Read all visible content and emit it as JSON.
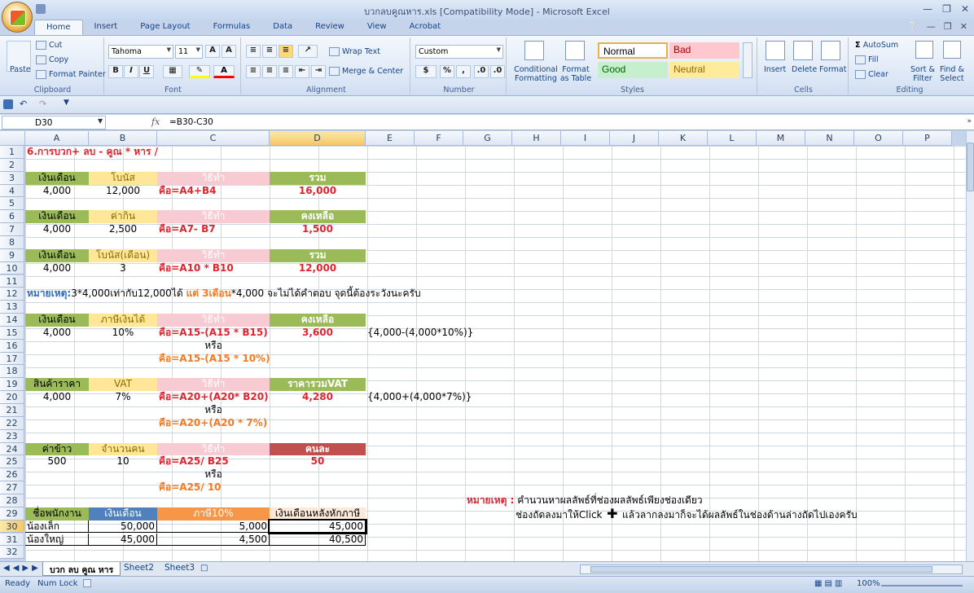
{
  "window": {
    "title": "บวกลบคูณหาร.xls  [Compatibility Mode] - Microsoft Excel"
  },
  "ribbon": {
    "tabs": [
      "Home",
      "Insert",
      "Page Layout",
      "Formulas",
      "Data",
      "Review",
      "View",
      "Acrobat"
    ],
    "clipboard": {
      "label": "Clipboard",
      "paste": "Paste",
      "cut": "Cut",
      "copy": "Copy",
      "format_painter": "Format Painter"
    },
    "font": {
      "label": "Font",
      "name": "Tahoma",
      "size": "11"
    },
    "alignment": {
      "label": "Alignment",
      "wrap": "Wrap Text",
      "merge": "Merge & Center"
    },
    "number": {
      "label": "Number",
      "format": "Custom"
    },
    "styles": {
      "label": "Styles",
      "conditional": "Conditional",
      "formatting": "Formatting",
      "format_as": "Format",
      "as_table": "as Table",
      "normal": "Normal",
      "bad": "Bad",
      "good": "Good",
      "neutral": "Neutral"
    },
    "cells": {
      "label": "Cells",
      "insert": "Insert",
      "delete": "Delete",
      "format": "Format"
    },
    "editing": {
      "label": "Editing",
      "autosum": "AutoSum",
      "fill": "Fill",
      "clear": "Clear",
      "sort": "Sort &",
      "filter": "Filter",
      "find": "Find &",
      "select": "Select"
    }
  },
  "formula_bar": {
    "name_box": "D30",
    "formula": "=B30-C30"
  },
  "columns": [
    "A",
    "B",
    "C",
    "D",
    "E",
    "F",
    "G",
    "H",
    "I",
    "J",
    "K",
    "L",
    "M",
    "N",
    "O",
    "P"
  ],
  "rows": [
    "1",
    "2",
    "3",
    "4",
    "5",
    "6",
    "7",
    "8",
    "9",
    "10",
    "11",
    "12",
    "13",
    "14",
    "15",
    "16",
    "17",
    "18",
    "19",
    "20",
    "21",
    "22",
    "23",
    "24",
    "25",
    "26",
    "27",
    "28",
    "29",
    "30",
    "31",
    "32"
  ],
  "cells": {
    "r1": "6.การบวก+ ลบ - คูณ * หาร /",
    "h_salary": "เงินเดือน",
    "h_bonus": "โบนัส",
    "h_method": "วิธีทำ",
    "h_total": "รวม",
    "r4a": "4,000",
    "r4b": "12,000",
    "r4c": "คือ=A4+B4",
    "r4d": "16,000",
    "h_food": "ค่ากิน",
    "h_remain": "คงเหลือ",
    "r7a": "4,000",
    "r7b": "2,500",
    "r7c": "คือ=A7- B7",
    "r7d": "1,500",
    "h_bonus_m": "โบนัส(เดือน)",
    "r10a": "4,000",
    "r10b": "3",
    "r10c": "คือ=A10 * B10",
    "r10d": "12,000",
    "r12_label": "หมายเหตุ:",
    "r12_text1": "3*4,000เท่ากับ12,000ได้ ",
    "r12_text2": "แต่ 3เดือน",
    "r12_text3": "*4,000 จะไม่ได้คำตอบ จุดนี้ต้องระวังนะครับ",
    "h_tax": "ภาษีเงินได้",
    "r15a": "4,000",
    "r15b": "10%",
    "r15c": "คือ=A15-(A15 * B15)",
    "r15d": "3,600",
    "r15e": "{4,000-(4,000*10%)}",
    "or": "หรือ",
    "r17c": "คือ=A15-(A15 * 10%)",
    "h_product": "สินค้าราคา",
    "h_vat": "VAT",
    "h_totalvat": "ราคารวมVAT",
    "r20a": "4,000",
    "r20b": "7%",
    "r20c": "คือ=A20+(A20* B20)",
    "r20d": "4,280",
    "r20e": "{4,000+(4,000*7%)}",
    "r22c": "คือ=A20+(A20 * 7%)",
    "h_rice": "ค่าข้าว",
    "h_people": "จำนวนคน",
    "h_per": "คนละ",
    "r25a": "500",
    "r25b": "10",
    "r25c": "คือ=A25/ B25",
    "r25d": "50",
    "r27c": "คือ=A25/ 10",
    "r28_label": "หมายเหตุ :",
    "r28_text": "คำนวนหาผลลัพธ์ที่ช่องผลลัพธ์เพียงช่องเดียว",
    "r29_text1": "ช่องถัดลงมาให้Click",
    "r29_text2": "แล้วลากลงมาก็จะได้ผลลัพธ์ในช่องด้านล่างถัดไปเองครับ",
    "h_emp": "ชื่อพนักงาน",
    "h_sal2": "เงินเดือน",
    "h_tax10": "ภาษี10%",
    "h_net": "เงินเดือนหลังหักภาษี",
    "r30a": "น้องเล็ก",
    "r30b": "50,000",
    "r30c": "5,000",
    "r30d": "45,000",
    "r31a": "น้องใหญ่",
    "r31b": "45,000",
    "r31c": "4,500",
    "r31d": "40,500"
  },
  "sheets": [
    "บวก ลบ คูณ หาร",
    "Sheet2",
    "Sheet3"
  ],
  "status": {
    "ready": "Ready",
    "numlock": "Num Lock",
    "zoom": "100%"
  },
  "colors": {
    "green": "#9bbb59",
    "yellow": "#ffe699",
    "pink": "#f8cbd3",
    "red": "#c0504d",
    "blue": "#4f81bd",
    "orange": "#f79646",
    "peach": "#fde9d9"
  }
}
